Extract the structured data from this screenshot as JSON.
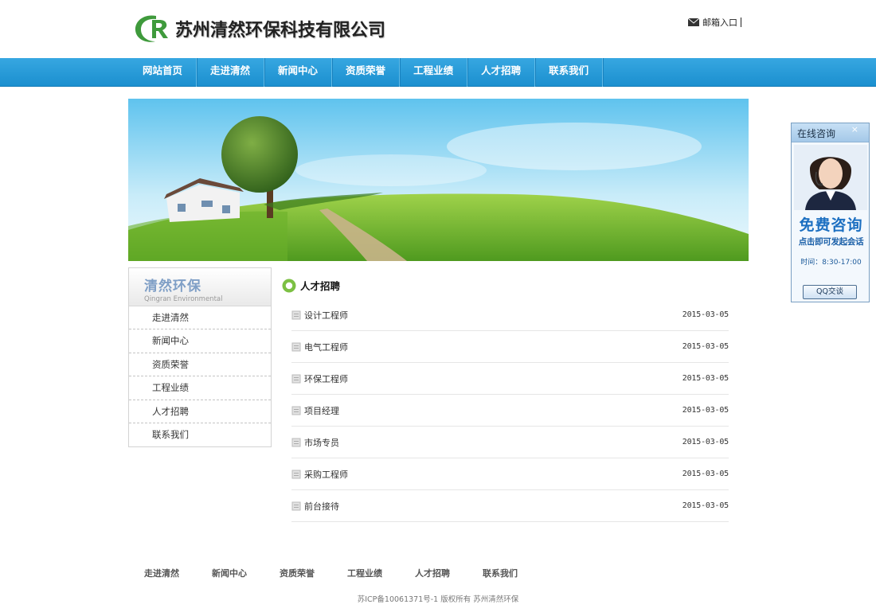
{
  "header": {
    "company_name": "苏州清然环保科技有限公司",
    "mail_label": "邮箱入口"
  },
  "nav": {
    "items": [
      "网站首页",
      "走进清然",
      "新闻中心",
      "资质荣誉",
      "工程业绩",
      "人才招聘",
      "联系我们"
    ]
  },
  "sidebar": {
    "title_cn": "清然环保",
    "title_en": "Qingran Environmental",
    "items": [
      "走进清然",
      "新闻中心",
      "资质荣誉",
      "工程业绩",
      "人才招聘",
      "联系我们"
    ]
  },
  "main": {
    "section_title": "人才招聘",
    "jobs": [
      {
        "title": "设计工程师",
        "date": "2015-03-05"
      },
      {
        "title": "电气工程师",
        "date": "2015-03-05"
      },
      {
        "title": "环保工程师",
        "date": "2015-03-05"
      },
      {
        "title": "项目经理",
        "date": "2015-03-05"
      },
      {
        "title": "市场专员",
        "date": "2015-03-05"
      },
      {
        "title": "采购工程师",
        "date": "2015-03-05"
      },
      {
        "title": "前台接待",
        "date": "2015-03-05"
      }
    ]
  },
  "footer": {
    "links": [
      "走进清然",
      "新闻中心",
      "资质荣誉",
      "工程业绩",
      "人才招聘",
      "联系我们"
    ],
    "copyright": "苏ICP备10061371号-1 版权所有 苏州清然环保"
  },
  "consult": {
    "title": "在线咨询",
    "close": "×",
    "free": "免费咨询",
    "sub": "点击即可发起会话",
    "time": "时间：8:30-17:00",
    "button": "QQ交谈"
  },
  "colors": {
    "nav_blue": "#1b8fcf",
    "logo_green": "#3f9a3c"
  }
}
